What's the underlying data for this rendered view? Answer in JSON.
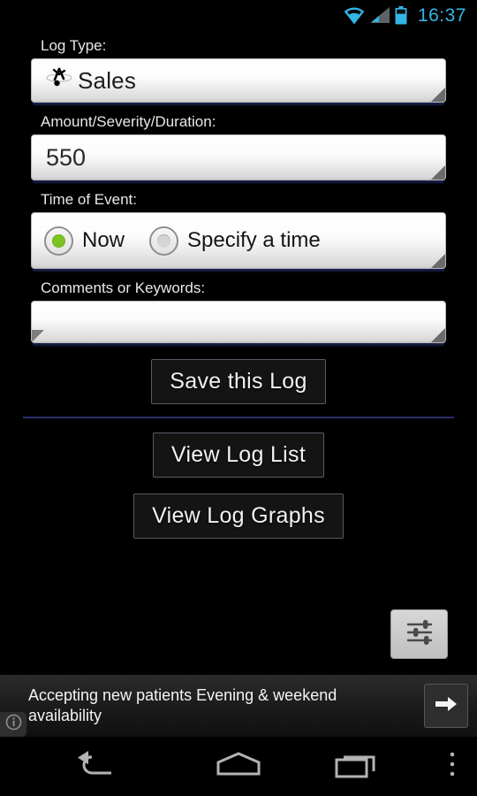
{
  "statusbar": {
    "time": "16:37",
    "icons": [
      "wifi-icon",
      "cellular-signal-icon",
      "battery-icon"
    ],
    "accent_color": "#33b5e5"
  },
  "form": {
    "log_type": {
      "label": "Log Type:",
      "selected_value": "Sales",
      "icon": "acrobat-figure-icon"
    },
    "amount": {
      "label": "Amount/Severity/Duration:",
      "value": "550",
      "placeholder": ""
    },
    "time_of_event": {
      "label": "Time of Event:",
      "options": [
        {
          "label": "Now",
          "selected": true
        },
        {
          "label": "Specify a time",
          "selected": false
        }
      ],
      "selected_color": "#7bc422"
    },
    "comments": {
      "label": "Comments or Keywords:",
      "value": "",
      "placeholder": ""
    }
  },
  "actions": {
    "save_label": "Save this Log",
    "view_list_label": "View Log List",
    "view_graphs_label": "View Log Graphs",
    "settings_icon": "equalizer-sliders-icon",
    "divider_color": "#2a2f6b"
  },
  "ad": {
    "text": "Accepting new patients Evening & weekend availability",
    "info_icon": "info-circle-icon",
    "arrow_icon": "arrow-right-icon"
  },
  "navbar": {
    "back": "back-icon",
    "home": "home-icon",
    "recents": "recents-icon",
    "menu": "overflow-menu-icon"
  }
}
